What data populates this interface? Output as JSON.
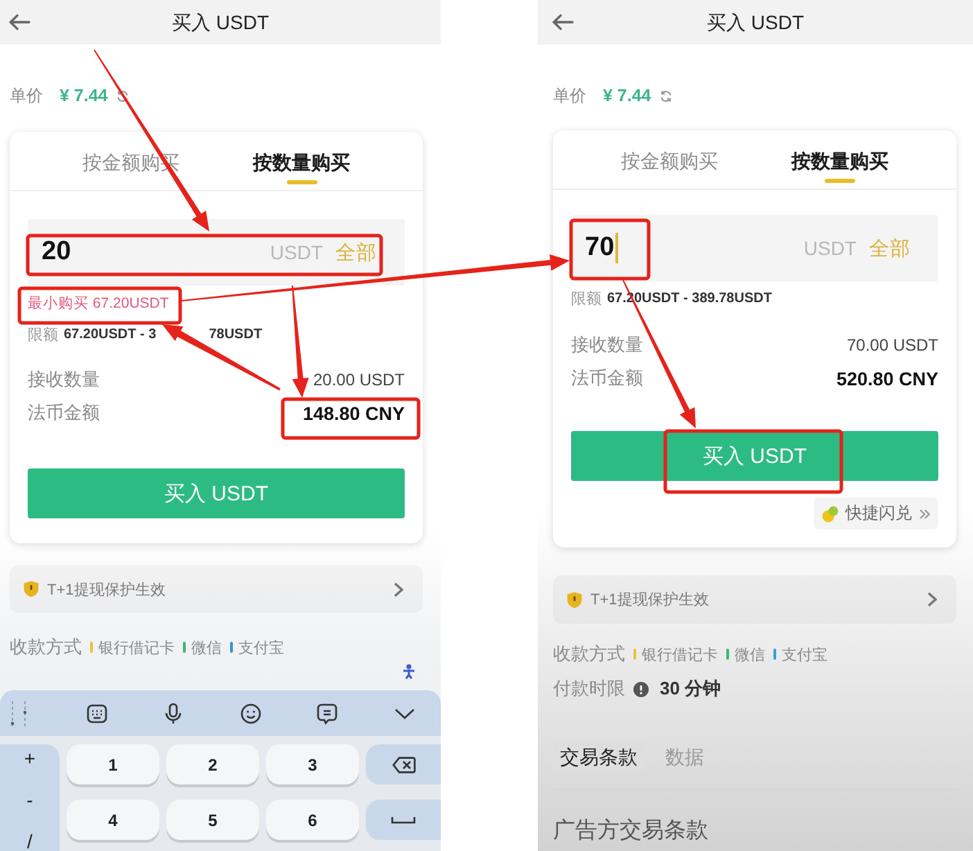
{
  "screens": [
    {
      "header": {
        "title": "买入 USDT"
      },
      "unit_price": {
        "label": "单价",
        "value": "¥ 7.44"
      },
      "tabs": [
        {
          "label": "按金额购买",
          "selected": false
        },
        {
          "label": "按数量购买",
          "selected": true
        }
      ],
      "amount_input": {
        "value": "20",
        "unit": "USDT",
        "max_label": "全部",
        "cursor": false
      },
      "min_purchase_hint": "最小购买 67.20USDT",
      "limit": {
        "label": "限额",
        "value_parts": [
          "67.20USDT - 3",
          "78USDT"
        ]
      },
      "summary": [
        {
          "label": "接收数量",
          "value": "20.00 USDT",
          "emphasis": false
        },
        {
          "label": "法币金额",
          "value": "148.80 CNY",
          "emphasis": true
        }
      ],
      "buy_button": "买入 USDT",
      "protection_notice": "T+1提现保护生效",
      "payment_methods": {
        "label": "收款方式",
        "methods": [
          {
            "name": "银行借记卡",
            "color": "#e8c43c"
          },
          {
            "name": "微信",
            "color": "#3bb873"
          },
          {
            "name": "支付宝",
            "color": "#3b8fde"
          }
        ]
      },
      "keyboard": {
        "symbol_keys": [
          "+",
          "-",
          "/"
        ],
        "digit_keys": [
          "1",
          "2",
          "3",
          "4",
          "5",
          "6"
        ]
      }
    },
    {
      "header": {
        "title": "买入 USDT"
      },
      "unit_price": {
        "label": "单价",
        "value": "¥ 7.44"
      },
      "tabs": [
        {
          "label": "按金额购买",
          "selected": false
        },
        {
          "label": "按数量购买",
          "selected": true
        }
      ],
      "amount_input": {
        "value": "70",
        "unit": "USDT",
        "max_label": "全部",
        "cursor": true
      },
      "limit": {
        "label": "限额",
        "value_parts": [
          "67.20USDT - 389.78USDT"
        ]
      },
      "summary": [
        {
          "label": "接收数量",
          "value": "70.00 USDT",
          "emphasis": false
        },
        {
          "label": "法币金额",
          "value": "520.80 CNY",
          "emphasis": true
        }
      ],
      "buy_button": "买入 USDT",
      "quick_swap": "快捷闪兑",
      "protection_notice": "T+1提现保护生效",
      "payment_methods": {
        "label": "收款方式",
        "methods": [
          {
            "name": "银行借记卡",
            "color": "#e8c43c"
          },
          {
            "name": "微信",
            "color": "#3bb873"
          },
          {
            "name": "支付宝",
            "color": "#3b9ed8"
          }
        ]
      },
      "payment_time": {
        "label": "付款时限",
        "value": "30 分钟"
      },
      "terms_tabs": [
        {
          "label": "交易条款",
          "selected": true
        },
        {
          "label": "数据",
          "selected": false
        }
      ],
      "terms_heading": "广告方交易条款"
    }
  ]
}
